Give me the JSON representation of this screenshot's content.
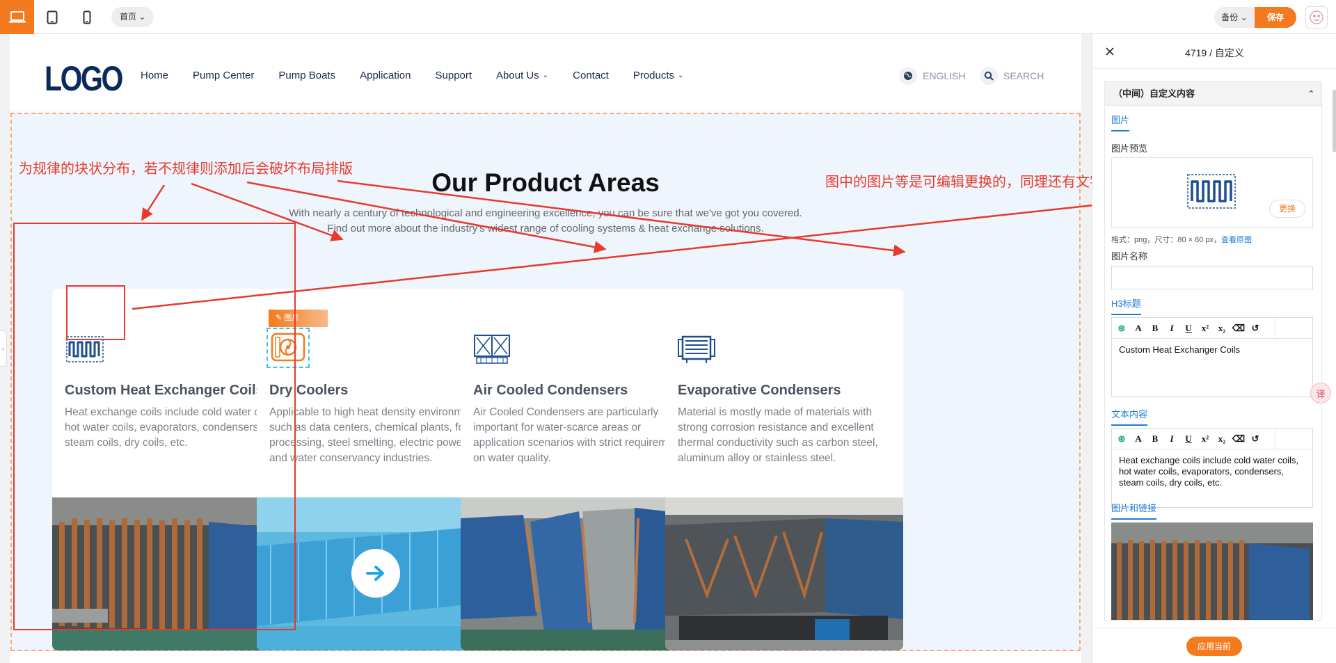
{
  "toolbar": {
    "page_select": "首页",
    "backup": "备份",
    "save": "保存"
  },
  "site": {
    "logo": "LOGO",
    "nav": [
      "Home",
      "Pump Center",
      "Pump Boats",
      "Application",
      "Support",
      "About Us",
      "Contact",
      "Products"
    ],
    "language": "ENGLISH",
    "search": "SEARCH"
  },
  "section": {
    "title": "Our Product Areas",
    "subtitle_line1": "With nearly a century of technological and engineering excellence, you can be sure that we've got you covered.",
    "subtitle_line2": "Find out more about the industry's widest range of cooling systems & heat exchange solutions.",
    "edit_tag": "图片",
    "cards": [
      {
        "title": "Custom Heat Exchanger Coils",
        "text": "Heat exchange coils include cold water coils, hot water coils, evaporators, condensers, steam coils, dry coils, etc.",
        "icon": "heat-exchanger-coil-icon"
      },
      {
        "title": "Dry Coolers",
        "text": "Applicable to high heat density environments such as data centers, chemical plants, food processing, steel smelting, electric power and water conservancy industries.",
        "icon": "dry-cooler-icon"
      },
      {
        "title": "Air Cooled Condensers",
        "text": "Air Cooled Condensers are particularly important for water-scarce areas or application scenarios with strict requirements on water quality.",
        "icon": "air-cooled-condenser-icon"
      },
      {
        "title": "Evaporative Condensers",
        "text": "Material is mostly made of materials with strong corrosion resistance and excellent thermal conductivity such as carbon steel, aluminum alloy or stainless steel.",
        "icon": "evaporative-condenser-icon"
      }
    ]
  },
  "annotations": {
    "left": "为规律的块状分布，若不规律则添加后会破坏布局排版",
    "right": "图中的图片等是可编辑更换的，同理还有文字"
  },
  "panel": {
    "title": "4719 / 自定义",
    "group": "（中间）自定义内容",
    "tab_image": "图片",
    "image_preview_label": "图片预览",
    "replace": "更换",
    "meta": "格式：png，尺寸：80 × 60 px，",
    "view_original": "查看原图",
    "image_name_label": "图片名称",
    "image_name_value": "",
    "h3_label": "H3标题",
    "h3_value": "Custom Heat Exchanger Coils",
    "text_label": "文本内容",
    "text_value": "Heat exchange coils include cold water coils, hot water coils, evaporators, condensers, steam coils, dry coils, etc.",
    "image_link_label": "图片和链接",
    "apply": "应用当前"
  },
  "colors": {
    "accent": "#f47a1f",
    "link": "#1e7cd6",
    "annotation": "#e8392c",
    "navy": "#0b2a5c"
  }
}
